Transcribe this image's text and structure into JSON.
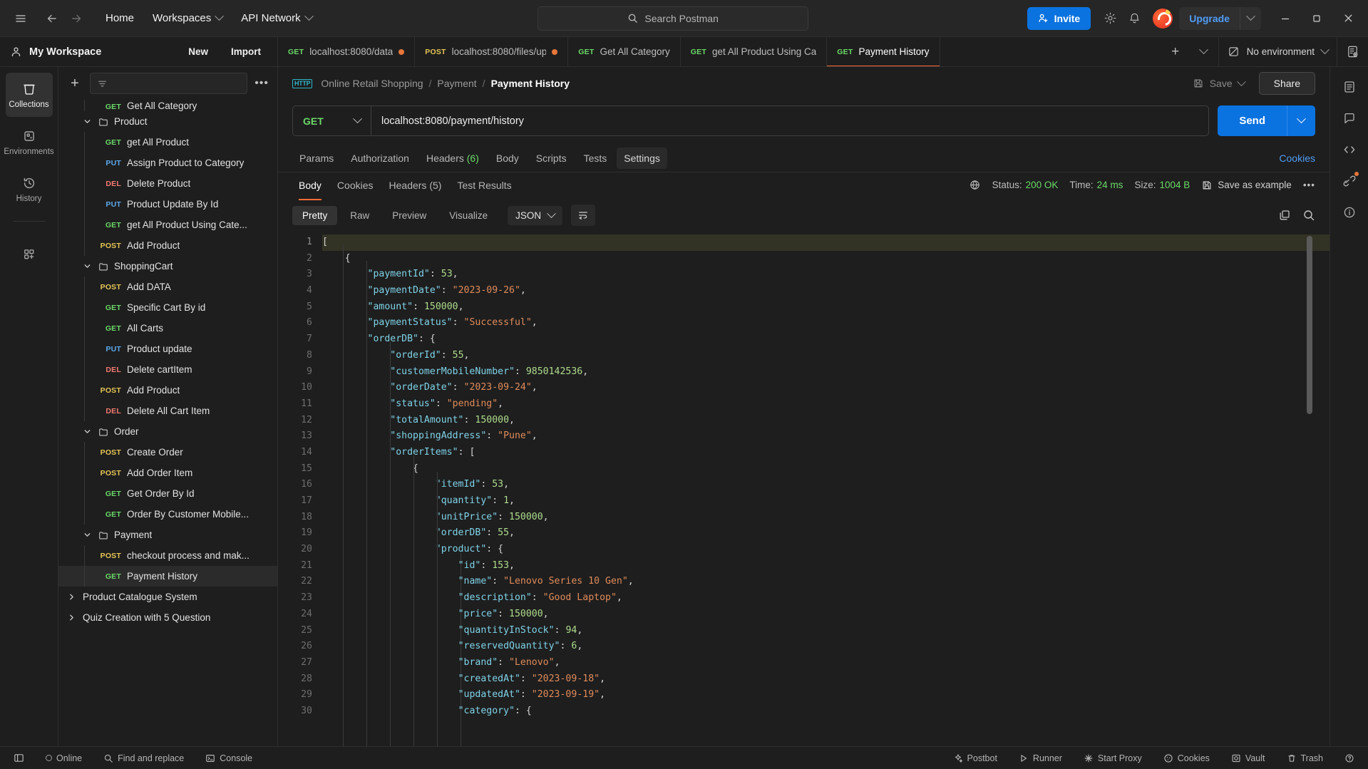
{
  "titlebar": {
    "hamburger_icon": "menu-icon",
    "back_icon": "arrow-left-icon",
    "forward_icon": "arrow-right-icon",
    "home": "Home",
    "workspaces": "Workspaces",
    "api_network": "API Network",
    "search_placeholder": "Search Postman",
    "invite": "Invite",
    "settings_icon": "gear-icon",
    "notifications_icon": "bell-icon",
    "upgrade": "Upgrade",
    "minimize_icon": "minimize-icon",
    "maximize_icon": "maximize-icon",
    "close_icon": "close-icon"
  },
  "workspace": {
    "name": "My Workspace",
    "new_label": "New",
    "import_label": "Import"
  },
  "tabs": [
    {
      "method": "GET",
      "label": "localhost:8080/data",
      "unsaved": true,
      "active": false
    },
    {
      "method": "POST",
      "label": "localhost:8080/files/up",
      "unsaved": true,
      "active": false
    },
    {
      "method": "GET",
      "label": "Get All Category",
      "unsaved": false,
      "active": false
    },
    {
      "method": "GET",
      "label": "get All Product Using Ca",
      "unsaved": false,
      "active": false
    },
    {
      "method": "GET",
      "label": "Payment History",
      "unsaved": false,
      "active": true
    }
  ],
  "environment": {
    "selected": "No environment"
  },
  "rail": [
    {
      "label": "Collections",
      "icon": "collections-icon",
      "active": true
    },
    {
      "label": "Environments",
      "icon": "environments-icon",
      "active": false
    },
    {
      "label": "History",
      "icon": "history-icon",
      "active": false
    },
    {
      "label": "",
      "icon": "apps-add-icon",
      "active": false
    }
  ],
  "sidebar": {
    "filter_placeholder": "",
    "items": [
      {
        "type": "request",
        "method": "GET",
        "label": "Get All Category",
        "indent": 2,
        "partial": true
      },
      {
        "type": "folder",
        "label": "Product",
        "indent": 1,
        "expanded": true
      },
      {
        "type": "request",
        "method": "GET",
        "label": "get All Product",
        "indent": 2
      },
      {
        "type": "request",
        "method": "PUT",
        "label": "Assign Product to Category",
        "indent": 2
      },
      {
        "type": "request",
        "method": "DEL",
        "label": "Delete Product",
        "indent": 2
      },
      {
        "type": "request",
        "method": "PUT",
        "label": "Product Update By Id",
        "indent": 2
      },
      {
        "type": "request",
        "method": "GET",
        "label": "get All Product Using Cate...",
        "indent": 2
      },
      {
        "type": "request",
        "method": "POST",
        "label": "Add Product",
        "indent": 2
      },
      {
        "type": "folder",
        "label": "ShoppingCart",
        "indent": 1,
        "expanded": true
      },
      {
        "type": "request",
        "method": "POST",
        "label": "Add DATA",
        "indent": 2
      },
      {
        "type": "request",
        "method": "GET",
        "label": "Specific Cart By id",
        "indent": 2
      },
      {
        "type": "request",
        "method": "GET",
        "label": "All Carts",
        "indent": 2
      },
      {
        "type": "request",
        "method": "PUT",
        "label": "Product update",
        "indent": 2
      },
      {
        "type": "request",
        "method": "DEL",
        "label": "Delete cartItem",
        "indent": 2
      },
      {
        "type": "request",
        "method": "POST",
        "label": "Add Product",
        "indent": 2
      },
      {
        "type": "request",
        "method": "DEL",
        "label": "Delete All Cart Item",
        "indent": 2
      },
      {
        "type": "folder",
        "label": "Order",
        "indent": 1,
        "expanded": true
      },
      {
        "type": "request",
        "method": "POST",
        "label": "Create Order",
        "indent": 2
      },
      {
        "type": "request",
        "method": "POST",
        "label": "Add Order Item",
        "indent": 2
      },
      {
        "type": "request",
        "method": "GET",
        "label": "Get Order By Id",
        "indent": 2
      },
      {
        "type": "request",
        "method": "GET",
        "label": "Order By Customer Mobile...",
        "indent": 2
      },
      {
        "type": "folder",
        "label": "Payment",
        "indent": 1,
        "expanded": true
      },
      {
        "type": "request",
        "method": "POST",
        "label": "checkout process and mak...",
        "indent": 2
      },
      {
        "type": "request",
        "method": "GET",
        "label": "Payment History",
        "indent": 2,
        "selected": true
      },
      {
        "type": "collection",
        "label": "Product Catalogue System",
        "indent": 0,
        "expanded": false
      },
      {
        "type": "collection",
        "label": "Quiz Creation with 5 Question",
        "indent": 0,
        "expanded": false
      }
    ]
  },
  "request": {
    "breadcrumb": [
      "Online Retail Shopping",
      "Payment",
      "Payment History"
    ],
    "save_label": "Save",
    "share_label": "Share",
    "method": "GET",
    "url": "localhost:8080/payment/history",
    "send_label": "Send",
    "tabs": [
      {
        "label": "Params",
        "count": ""
      },
      {
        "label": "Authorization",
        "count": ""
      },
      {
        "label": "Headers",
        "count": "(6)"
      },
      {
        "label": "Body",
        "count": ""
      },
      {
        "label": "Scripts",
        "count": ""
      },
      {
        "label": "Tests",
        "count": ""
      },
      {
        "label": "Settings",
        "count": "",
        "hover": true
      }
    ],
    "cookies_link": "Cookies"
  },
  "response": {
    "tabs": [
      {
        "label": "Body",
        "count": "",
        "active": true
      },
      {
        "label": "Cookies",
        "count": ""
      },
      {
        "label": "Headers",
        "count": "(5)"
      },
      {
        "label": "Test Results",
        "count": ""
      }
    ],
    "status_label": "Status:",
    "status_value": "200 OK",
    "time_label": "Time:",
    "time_value": "24 ms",
    "size_label": "Size:",
    "size_value": "1004 B",
    "save_as_example": "Save as example",
    "views": [
      "Pretty",
      "Raw",
      "Preview",
      "Visualize"
    ],
    "active_view": "Pretty",
    "format": "JSON",
    "body_lines": [
      {
        "n": 1,
        "indent": 0,
        "tokens": [
          [
            "p",
            "["
          ]
        ]
      },
      {
        "n": 2,
        "indent": 1,
        "tokens": [
          [
            "p",
            "{"
          ]
        ]
      },
      {
        "n": 3,
        "indent": 2,
        "tokens": [
          [
            "k",
            "\"paymentId\""
          ],
          [
            "p",
            ": "
          ],
          [
            "n",
            "53"
          ],
          [
            "p",
            ","
          ]
        ]
      },
      {
        "n": 4,
        "indent": 2,
        "tokens": [
          [
            "k",
            "\"paymentDate\""
          ],
          [
            "p",
            ": "
          ],
          [
            "s",
            "\"2023-09-26\""
          ],
          [
            "p",
            ","
          ]
        ]
      },
      {
        "n": 5,
        "indent": 2,
        "tokens": [
          [
            "k",
            "\"amount\""
          ],
          [
            "p",
            ": "
          ],
          [
            "n",
            "150000"
          ],
          [
            "p",
            ","
          ]
        ]
      },
      {
        "n": 6,
        "indent": 2,
        "tokens": [
          [
            "k",
            "\"paymentStatus\""
          ],
          [
            "p",
            ": "
          ],
          [
            "s",
            "\"Successful\""
          ],
          [
            "p",
            ","
          ]
        ]
      },
      {
        "n": 7,
        "indent": 2,
        "tokens": [
          [
            "k",
            "\"orderDB\""
          ],
          [
            "p",
            ": {"
          ]
        ]
      },
      {
        "n": 8,
        "indent": 3,
        "tokens": [
          [
            "k",
            "\"orderId\""
          ],
          [
            "p",
            ": "
          ],
          [
            "n",
            "55"
          ],
          [
            "p",
            ","
          ]
        ]
      },
      {
        "n": 9,
        "indent": 3,
        "tokens": [
          [
            "k",
            "\"customerMobileNumber\""
          ],
          [
            "p",
            ": "
          ],
          [
            "n",
            "9850142536"
          ],
          [
            "p",
            ","
          ]
        ]
      },
      {
        "n": 10,
        "indent": 3,
        "tokens": [
          [
            "k",
            "\"orderDate\""
          ],
          [
            "p",
            ": "
          ],
          [
            "s",
            "\"2023-09-24\""
          ],
          [
            "p",
            ","
          ]
        ]
      },
      {
        "n": 11,
        "indent": 3,
        "tokens": [
          [
            "k",
            "\"status\""
          ],
          [
            "p",
            ": "
          ],
          [
            "s",
            "\"pending\""
          ],
          [
            "p",
            ","
          ]
        ]
      },
      {
        "n": 12,
        "indent": 3,
        "tokens": [
          [
            "k",
            "\"totalAmount\""
          ],
          [
            "p",
            ": "
          ],
          [
            "n",
            "150000"
          ],
          [
            "p",
            ","
          ]
        ]
      },
      {
        "n": 13,
        "indent": 3,
        "tokens": [
          [
            "k",
            "\"shoppingAddress\""
          ],
          [
            "p",
            ": "
          ],
          [
            "s",
            "\"Pune\""
          ],
          [
            "p",
            ","
          ]
        ]
      },
      {
        "n": 14,
        "indent": 3,
        "tokens": [
          [
            "k",
            "\"orderItems\""
          ],
          [
            "p",
            ": ["
          ]
        ]
      },
      {
        "n": 15,
        "indent": 4,
        "tokens": [
          [
            "p",
            "{"
          ]
        ]
      },
      {
        "n": 16,
        "indent": 5,
        "tokens": [
          [
            "k",
            "\"itemId\""
          ],
          [
            "p",
            ": "
          ],
          [
            "n",
            "53"
          ],
          [
            "p",
            ","
          ]
        ]
      },
      {
        "n": 17,
        "indent": 5,
        "tokens": [
          [
            "k",
            "\"quantity\""
          ],
          [
            "p",
            ": "
          ],
          [
            "n",
            "1"
          ],
          [
            "p",
            ","
          ]
        ]
      },
      {
        "n": 18,
        "indent": 5,
        "tokens": [
          [
            "k",
            "\"unitPrice\""
          ],
          [
            "p",
            ": "
          ],
          [
            "n",
            "150000"
          ],
          [
            "p",
            ","
          ]
        ]
      },
      {
        "n": 19,
        "indent": 5,
        "tokens": [
          [
            "k",
            "\"orderDB\""
          ],
          [
            "p",
            ": "
          ],
          [
            "n",
            "55"
          ],
          [
            "p",
            ","
          ]
        ]
      },
      {
        "n": 20,
        "indent": 5,
        "tokens": [
          [
            "k",
            "\"product\""
          ],
          [
            "p",
            ": {"
          ]
        ]
      },
      {
        "n": 21,
        "indent": 6,
        "tokens": [
          [
            "k",
            "\"id\""
          ],
          [
            "p",
            ": "
          ],
          [
            "n",
            "153"
          ],
          [
            "p",
            ","
          ]
        ]
      },
      {
        "n": 22,
        "indent": 6,
        "tokens": [
          [
            "k",
            "\"name\""
          ],
          [
            "p",
            ": "
          ],
          [
            "s",
            "\"Lenovo Series 10 Gen\""
          ],
          [
            "p",
            ","
          ]
        ]
      },
      {
        "n": 23,
        "indent": 6,
        "tokens": [
          [
            "k",
            "\"description\""
          ],
          [
            "p",
            ": "
          ],
          [
            "s",
            "\"Good Laptop\""
          ],
          [
            "p",
            ","
          ]
        ]
      },
      {
        "n": 24,
        "indent": 6,
        "tokens": [
          [
            "k",
            "\"price\""
          ],
          [
            "p",
            ": "
          ],
          [
            "n",
            "150000"
          ],
          [
            "p",
            ","
          ]
        ]
      },
      {
        "n": 25,
        "indent": 6,
        "tokens": [
          [
            "k",
            "\"quantityInStock\""
          ],
          [
            "p",
            ": "
          ],
          [
            "n",
            "94"
          ],
          [
            "p",
            ","
          ]
        ]
      },
      {
        "n": 26,
        "indent": 6,
        "tokens": [
          [
            "k",
            "\"reservedQuantity\""
          ],
          [
            "p",
            ": "
          ],
          [
            "n",
            "6"
          ],
          [
            "p",
            ","
          ]
        ]
      },
      {
        "n": 27,
        "indent": 6,
        "tokens": [
          [
            "k",
            "\"brand\""
          ],
          [
            "p",
            ": "
          ],
          [
            "s",
            "\"Lenovo\""
          ],
          [
            "p",
            ","
          ]
        ]
      },
      {
        "n": 28,
        "indent": 6,
        "tokens": [
          [
            "k",
            "\"createdAt\""
          ],
          [
            "p",
            ": "
          ],
          [
            "s",
            "\"2023-09-18\""
          ],
          [
            "p",
            ","
          ]
        ]
      },
      {
        "n": 29,
        "indent": 6,
        "tokens": [
          [
            "k",
            "\"updatedAt\""
          ],
          [
            "p",
            ": "
          ],
          [
            "s",
            "\"2023-09-19\""
          ],
          [
            "p",
            ","
          ]
        ]
      },
      {
        "n": 30,
        "indent": 6,
        "tokens": [
          [
            "k",
            "\"category\""
          ],
          [
            "p",
            ": {"
          ]
        ]
      }
    ]
  },
  "statusbar": {
    "left": [
      {
        "label": "",
        "icon": "sidebar-toggle-icon"
      },
      {
        "label": "Online",
        "icon": "online-icon"
      },
      {
        "label": "Find and replace",
        "icon": "search-icon"
      },
      {
        "label": "Console",
        "icon": "console-icon"
      }
    ],
    "right": [
      {
        "label": "Postbot",
        "icon": "postbot-icon"
      },
      {
        "label": "Runner",
        "icon": "runner-icon"
      },
      {
        "label": "Start Proxy",
        "icon": "proxy-icon"
      },
      {
        "label": "Cookies",
        "icon": "cookies-icon"
      },
      {
        "label": "Vault",
        "icon": "vault-icon"
      },
      {
        "label": "Trash",
        "icon": "trash-icon"
      },
      {
        "label": "",
        "icon": "help-icon"
      }
    ]
  },
  "colors": {
    "accent": "#ff6c37",
    "primary": "#0b73e0",
    "success": "#6bd968",
    "get": "#6bd968",
    "post": "#e6c555",
    "put": "#5da9ef",
    "delete": "#f27a72"
  }
}
